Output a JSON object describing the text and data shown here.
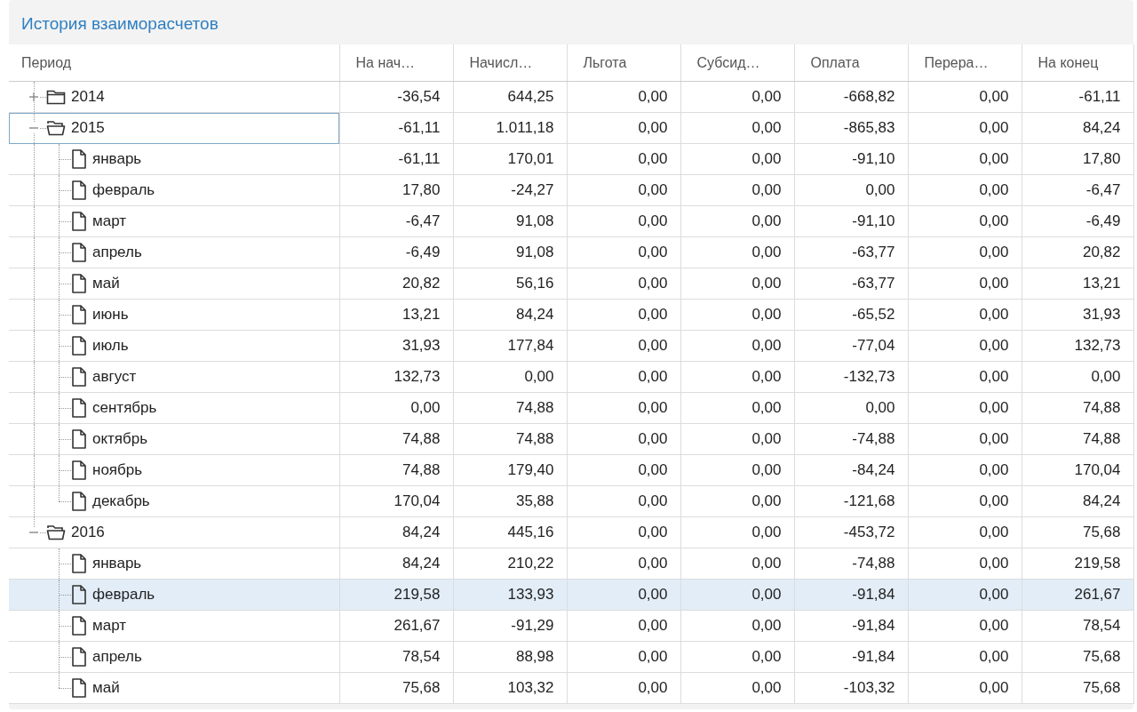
{
  "panel": {
    "title": "История взаиморасчетов"
  },
  "table": {
    "columns": [
      "Период",
      "На нач…",
      "Начисл…",
      "Льгота",
      "Субсид…",
      "Оплата",
      "Перера…",
      "На конец"
    ],
    "rows": [
      {
        "label": "2014",
        "expanded": false,
        "focused": false,
        "selected": false,
        "values": [
          "-36,54",
          "644,25",
          "0,00",
          "0,00",
          "-668,82",
          "0,00",
          "-61,11"
        ]
      },
      {
        "label": "2015",
        "expanded": true,
        "focused": true,
        "selected": false,
        "values": [
          "-61,11",
          "1.011,18",
          "0,00",
          "0,00",
          "-865,83",
          "0,00",
          "84,24"
        ],
        "children": [
          {
            "label": "январь",
            "selected": false,
            "values": [
              "-61,11",
              "170,01",
              "0,00",
              "0,00",
              "-91,10",
              "0,00",
              "17,80"
            ]
          },
          {
            "label": "февраль",
            "selected": false,
            "values": [
              "17,80",
              "-24,27",
              "0,00",
              "0,00",
              "0,00",
              "0,00",
              "-6,47"
            ]
          },
          {
            "label": "март",
            "selected": false,
            "values": [
              "-6,47",
              "91,08",
              "0,00",
              "0,00",
              "-91,10",
              "0,00",
              "-6,49"
            ]
          },
          {
            "label": "апрель",
            "selected": false,
            "values": [
              "-6,49",
              "91,08",
              "0,00",
              "0,00",
              "-63,77",
              "0,00",
              "20,82"
            ]
          },
          {
            "label": "май",
            "selected": false,
            "values": [
              "20,82",
              "56,16",
              "0,00",
              "0,00",
              "-63,77",
              "0,00",
              "13,21"
            ]
          },
          {
            "label": "июнь",
            "selected": false,
            "values": [
              "13,21",
              "84,24",
              "0,00",
              "0,00",
              "-65,52",
              "0,00",
              "31,93"
            ]
          },
          {
            "label": "июль",
            "selected": false,
            "values": [
              "31,93",
              "177,84",
              "0,00",
              "0,00",
              "-77,04",
              "0,00",
              "132,73"
            ]
          },
          {
            "label": "август",
            "selected": false,
            "values": [
              "132,73",
              "0,00",
              "0,00",
              "0,00",
              "-132,73",
              "0,00",
              "0,00"
            ]
          },
          {
            "label": "сентябрь",
            "selected": false,
            "values": [
              "0,00",
              "74,88",
              "0,00",
              "0,00",
              "0,00",
              "0,00",
              "74,88"
            ]
          },
          {
            "label": "октябрь",
            "selected": false,
            "values": [
              "74,88",
              "74,88",
              "0,00",
              "0,00",
              "-74,88",
              "0,00",
              "74,88"
            ]
          },
          {
            "label": "ноябрь",
            "selected": false,
            "values": [
              "74,88",
              "179,40",
              "0,00",
              "0,00",
              "-84,24",
              "0,00",
              "170,04"
            ]
          },
          {
            "label": "декабрь",
            "selected": false,
            "values": [
              "170,04",
              "35,88",
              "0,00",
              "0,00",
              "-121,68",
              "0,00",
              "84,24"
            ]
          }
        ]
      },
      {
        "label": "2016",
        "expanded": true,
        "focused": false,
        "selected": false,
        "values": [
          "84,24",
          "445,16",
          "0,00",
          "0,00",
          "-453,72",
          "0,00",
          "75,68"
        ],
        "children": [
          {
            "label": "январь",
            "selected": false,
            "values": [
              "84,24",
              "210,22",
              "0,00",
              "0,00",
              "-74,88",
              "0,00",
              "219,58"
            ]
          },
          {
            "label": "февраль",
            "selected": true,
            "values": [
              "219,58",
              "133,93",
              "0,00",
              "0,00",
              "-91,84",
              "0,00",
              "261,67"
            ]
          },
          {
            "label": "март",
            "selected": false,
            "values": [
              "261,67",
              "-91,29",
              "0,00",
              "0,00",
              "-91,84",
              "0,00",
              "78,54"
            ]
          },
          {
            "label": "апрель",
            "selected": false,
            "values": [
              "78,54",
              "88,98",
              "0,00",
              "0,00",
              "-91,84",
              "0,00",
              "75,68"
            ]
          },
          {
            "label": "май",
            "selected": false,
            "values": [
              "75,68",
              "103,32",
              "0,00",
              "0,00",
              "-103,32",
              "0,00",
              "75,68"
            ]
          }
        ]
      }
    ]
  }
}
